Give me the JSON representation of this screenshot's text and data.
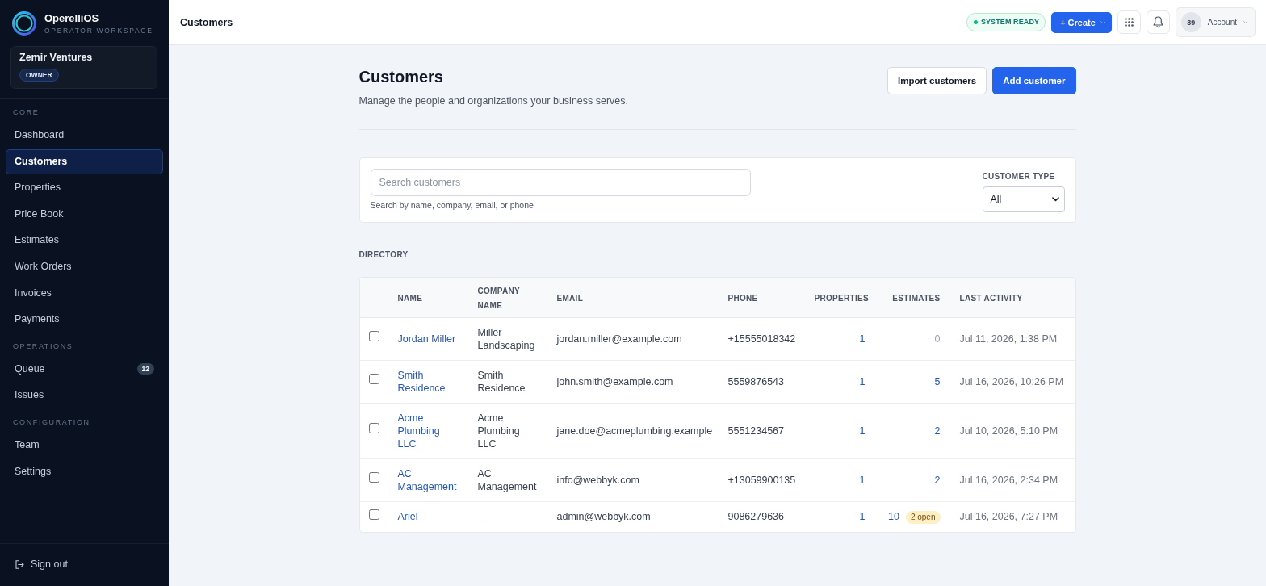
{
  "sidebar": {
    "brand": {
      "name": "OperelliOS",
      "subtitle": "OPERATOR WORKSPACE"
    },
    "workspace": {
      "name": "Zemir Ventures",
      "role": "OWNER"
    },
    "sections": [
      {
        "title": "CORE",
        "items": [
          {
            "label": "Dashboard",
            "selected": false
          },
          {
            "label": "Customers",
            "selected": true
          },
          {
            "label": "Properties",
            "selected": false
          },
          {
            "label": "Price Book",
            "selected": false
          },
          {
            "label": "Estimates",
            "selected": false
          },
          {
            "label": "Work Orders",
            "selected": false
          },
          {
            "label": "Invoices",
            "selected": false
          },
          {
            "label": "Payments",
            "selected": false
          }
        ]
      },
      {
        "title": "OPERATIONS",
        "items": [
          {
            "label": "Queue",
            "selected": false,
            "badge": "12"
          },
          {
            "label": "Issues",
            "selected": false
          }
        ]
      },
      {
        "title": "CONFIGURATION",
        "items": [
          {
            "label": "Team",
            "selected": false
          },
          {
            "label": "Settings",
            "selected": false
          }
        ]
      }
    ],
    "sign_out": "Sign out"
  },
  "topbar": {
    "title": "Customers",
    "status": "SYSTEM READY",
    "create": "+ Create",
    "avatar": "39",
    "account": "Account"
  },
  "header": {
    "title": "Customers",
    "subtitle": "Manage the people and organizations your business serves.",
    "buttons": [
      {
        "label": "Import customers",
        "kind": "secondary"
      },
      {
        "label": "Add customer",
        "kind": "primary"
      }
    ]
  },
  "filters": {
    "search": {
      "placeholder": "Search customers",
      "hint": "Search by name, company, email, or phone"
    },
    "customer_type": {
      "label": "CUSTOMER TYPE",
      "value": "All"
    }
  },
  "directory": {
    "title": "DIRECTORY",
    "columns": [
      "NAME",
      "COMPANY NAME",
      "EMAIL",
      "PHONE",
      "PROPERTIES",
      "ESTIMATES",
      "LAST ACTIVITY"
    ],
    "rows": [
      {
        "checked": false,
        "name": "Jordan Miller",
        "company": "Miller Landscaping",
        "company_muted": false,
        "email": "jordan.miller@example.com",
        "phone": "+15555018342",
        "properties": "1",
        "estimates": "0",
        "estimates_muted": true,
        "last_activity": "Jul 11, 2026, 1:38 PM"
      },
      {
        "checked": false,
        "name": "Smith Residence",
        "company": "Smith Residence",
        "company_muted": false,
        "email": "john.smith@example.com",
        "phone": "5559876543",
        "properties": "1",
        "estimates": "5",
        "estimates_muted": false,
        "last_activity": "Jul 16, 2026, 10:26 PM"
      },
      {
        "checked": false,
        "name": "Acme Plumbing LLC",
        "company": "Acme Plumbing LLC",
        "company_muted": false,
        "email": "jane.doe@acmeplumbing.example",
        "phone": "5551234567",
        "properties": "1",
        "estimates": "2",
        "estimates_muted": false,
        "last_activity": "Jul 10, 2026, 5:10 PM"
      },
      {
        "checked": false,
        "name": "AC Management",
        "company": "AC Management",
        "company_muted": false,
        "email": "info@webbyk.com",
        "phone": "+13059900135",
        "properties": "1",
        "estimates": "2",
        "estimates_muted": false,
        "last_activity": "Jul 16, 2026, 2:34 PM"
      },
      {
        "checked": false,
        "name": "Ariel",
        "company": "—",
        "company_muted": true,
        "email": "admin@webbyk.com",
        "phone": "9086279636",
        "properties": "1",
        "estimates": "10",
        "estimates_muted": false,
        "estimates_badge": "2 open",
        "last_activity": "Jul 16, 2026, 7:27 PM"
      }
    ]
  }
}
